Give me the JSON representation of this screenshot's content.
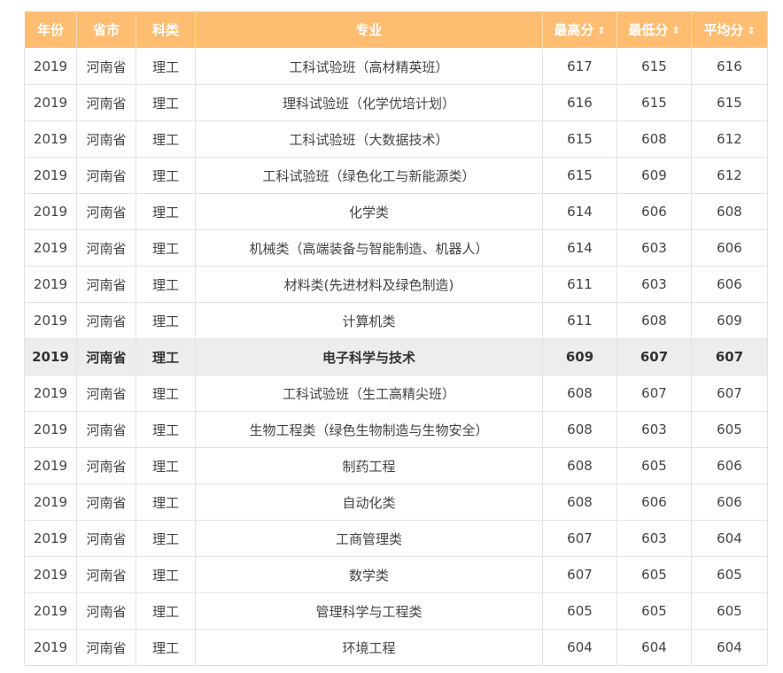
{
  "table": {
    "headers": {
      "year": "年份",
      "province": "省市",
      "category": "科类",
      "major": "专业",
      "max": "最高分",
      "min": "最低分",
      "avg": "平均分"
    },
    "sort_icon": "⇕",
    "highlight_color": "#ededed",
    "header_color": "#ffbd71",
    "rows": [
      {
        "year": "2019",
        "province": "河南省",
        "category": "理工",
        "major": "工科试验班（高材精英班）",
        "max": "617",
        "min": "615",
        "avg": "616",
        "highlight": false
      },
      {
        "year": "2019",
        "province": "河南省",
        "category": "理工",
        "major": "理科试验班（化学优培计划）",
        "max": "616",
        "min": "615",
        "avg": "615",
        "highlight": false
      },
      {
        "year": "2019",
        "province": "河南省",
        "category": "理工",
        "major": "工科试验班（大数据技术）",
        "max": "615",
        "min": "608",
        "avg": "612",
        "highlight": false
      },
      {
        "year": "2019",
        "province": "河南省",
        "category": "理工",
        "major": "工科试验班（绿色化工与新能源类）",
        "max": "615",
        "min": "609",
        "avg": "612",
        "highlight": false
      },
      {
        "year": "2019",
        "province": "河南省",
        "category": "理工",
        "major": "化学类",
        "max": "614",
        "min": "606",
        "avg": "608",
        "highlight": false
      },
      {
        "year": "2019",
        "province": "河南省",
        "category": "理工",
        "major": "机械类（高端装备与智能制造、机器人）",
        "max": "614",
        "min": "603",
        "avg": "606",
        "highlight": false
      },
      {
        "year": "2019",
        "province": "河南省",
        "category": "理工",
        "major": "材料类(先进材料及绿色制造)",
        "max": "611",
        "min": "603",
        "avg": "606",
        "highlight": false
      },
      {
        "year": "2019",
        "province": "河南省",
        "category": "理工",
        "major": "计算机类",
        "max": "611",
        "min": "608",
        "avg": "609",
        "highlight": false
      },
      {
        "year": "2019",
        "province": "河南省",
        "category": "理工",
        "major": "电子科学与技术",
        "max": "609",
        "min": "607",
        "avg": "607",
        "highlight": true
      },
      {
        "year": "2019",
        "province": "河南省",
        "category": "理工",
        "major": "工科试验班（生工高精尖班）",
        "max": "608",
        "min": "607",
        "avg": "607",
        "highlight": false
      },
      {
        "year": "2019",
        "province": "河南省",
        "category": "理工",
        "major": "生物工程类（绿色生物制造与生物安全）",
        "max": "608",
        "min": "603",
        "avg": "605",
        "highlight": false
      },
      {
        "year": "2019",
        "province": "河南省",
        "category": "理工",
        "major": "制药工程",
        "max": "608",
        "min": "605",
        "avg": "606",
        "highlight": false
      },
      {
        "year": "2019",
        "province": "河南省",
        "category": "理工",
        "major": "自动化类",
        "max": "608",
        "min": "606",
        "avg": "606",
        "highlight": false
      },
      {
        "year": "2019",
        "province": "河南省",
        "category": "理工",
        "major": "工商管理类",
        "max": "607",
        "min": "603",
        "avg": "604",
        "highlight": false
      },
      {
        "year": "2019",
        "province": "河南省",
        "category": "理工",
        "major": "数学类",
        "max": "607",
        "min": "605",
        "avg": "605",
        "highlight": false
      },
      {
        "year": "2019",
        "province": "河南省",
        "category": "理工",
        "major": "管理科学与工程类",
        "max": "605",
        "min": "605",
        "avg": "605",
        "highlight": false
      },
      {
        "year": "2019",
        "province": "河南省",
        "category": "理工",
        "major": "环境工程",
        "max": "604",
        "min": "604",
        "avg": "604",
        "highlight": false
      }
    ]
  }
}
